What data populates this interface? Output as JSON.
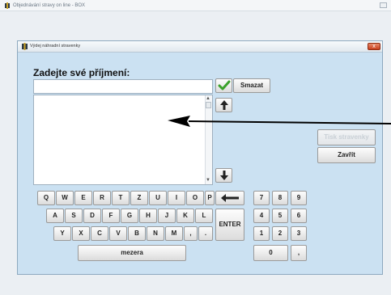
{
  "outer_window": {
    "title": "Objednávání stravy on line - BOX"
  },
  "dialog": {
    "title": "Výdej náhradní stravenky",
    "close_glyph": "x",
    "prompt": "Zadejte své příjmení:",
    "name_input": {
      "value": "",
      "placeholder": ""
    },
    "list_items": []
  },
  "buttons": {
    "ok_icon": "check-icon",
    "smazat": "Smazat",
    "up_icon": "arrow-up-icon",
    "down_icon": "arrow-down-icon",
    "tisk": "Tisk stravenky",
    "zavrit": "Zavřít"
  },
  "keyboard": {
    "row1": [
      "Q",
      "W",
      "E",
      "R",
      "T",
      "Z",
      "U",
      "I",
      "O",
      "P"
    ],
    "row2": [
      "A",
      "S",
      "D",
      "F",
      "G",
      "H",
      "J",
      "K",
      "L"
    ],
    "row3": [
      "Y",
      "X",
      "C",
      "V",
      "B",
      "N",
      "M",
      ",",
      "."
    ],
    "backspace_icon": "backspace-arrow-icon",
    "enter": "ENTER",
    "space": "mezera",
    "numpad": [
      [
        "7",
        "8",
        "9"
      ],
      [
        "4",
        "5",
        "6"
      ],
      [
        "1",
        "2",
        "3"
      ],
      [
        "0",
        ","
      ]
    ]
  },
  "colors": {
    "dialog_bg": "#cbe1f2",
    "close_button": "#d9542e",
    "annotation": "#000000"
  }
}
